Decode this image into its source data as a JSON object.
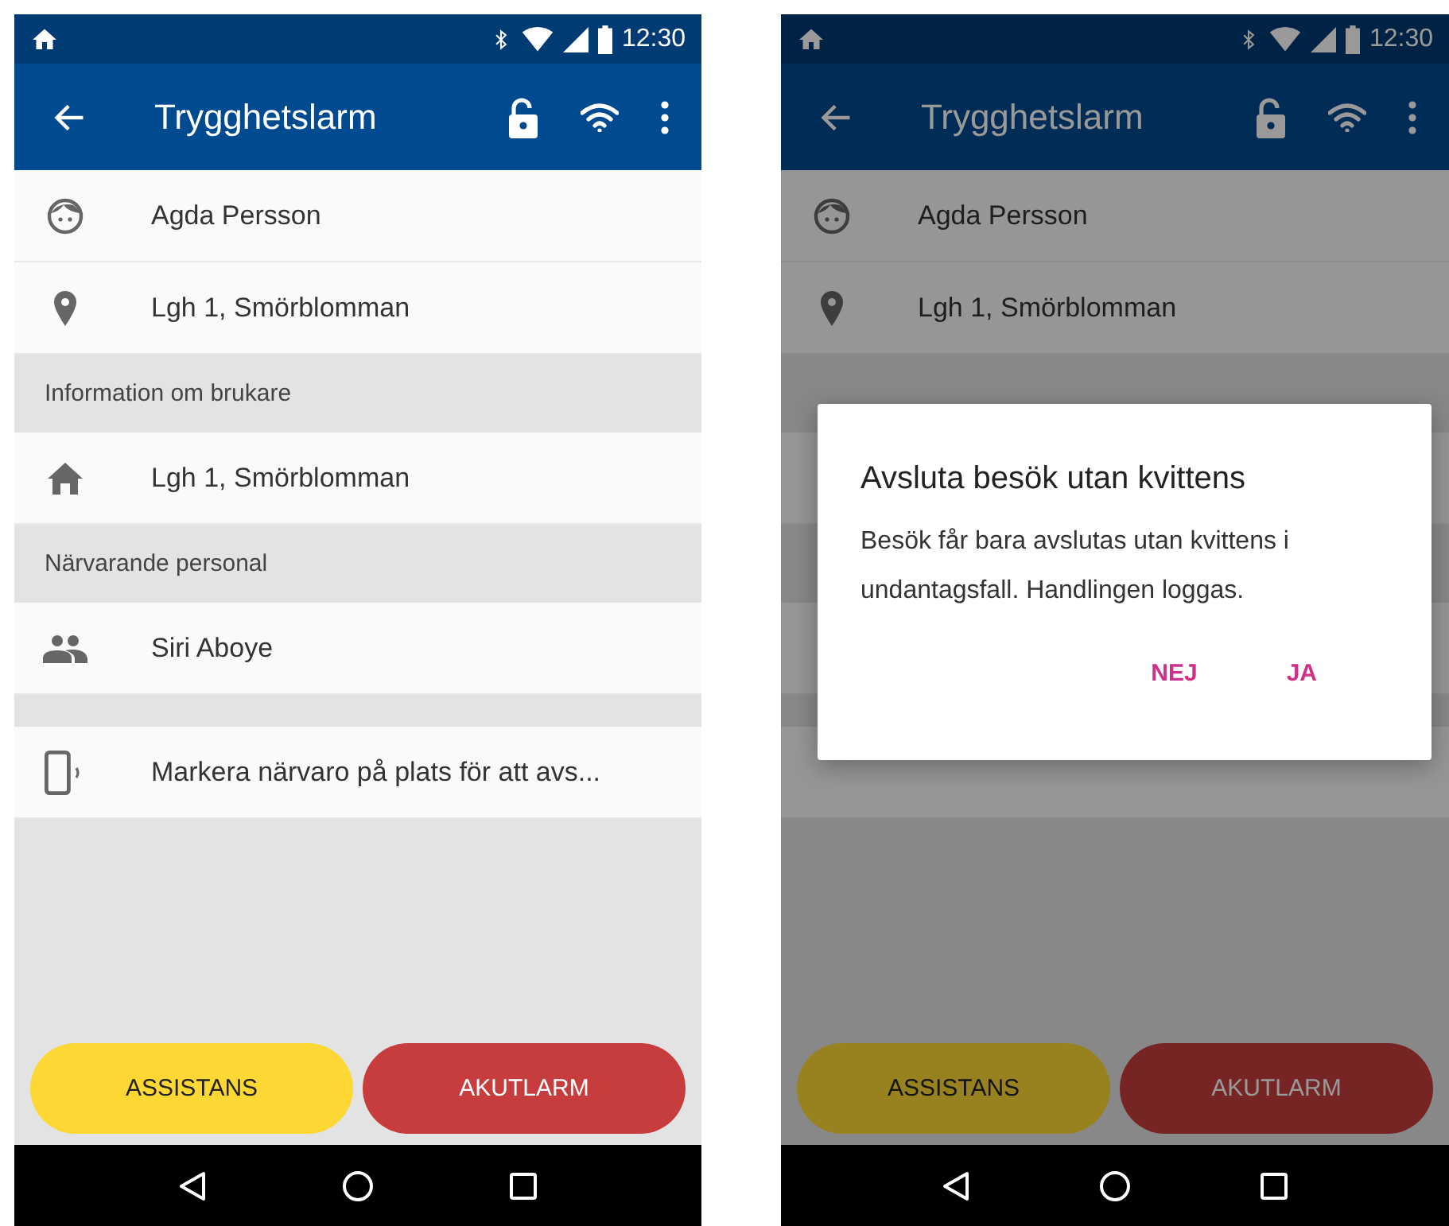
{
  "screens": [
    {
      "status_time": "12:30",
      "title": "Trygghetslarm",
      "dimmed": false,
      "rows": [
        {
          "kind": "user",
          "text": "Agda Persson"
        },
        {
          "kind": "address",
          "text": "Lgh 1, Smörblomman"
        },
        {
          "kind": "header",
          "text": "Information om brukare"
        },
        {
          "kind": "home",
          "text": "Lgh 1, Smörblomman"
        },
        {
          "kind": "header",
          "text": "Närvarande personal"
        },
        {
          "kind": "staff",
          "text": "Siri Aboye"
        },
        {
          "kind": "spacer"
        },
        {
          "kind": "presence",
          "text": "Markera närvaro på plats för att avs..."
        }
      ],
      "buttons": [
        {
          "label": "ASSISTANS",
          "kind": "assist"
        },
        {
          "label": "AKUTLARM",
          "kind": "alarm"
        }
      ]
    },
    {
      "status_time": "12:30",
      "title": "Trygghetslarm",
      "dimmed": true,
      "rows": [
        {
          "kind": "user",
          "text": "Agda Persson"
        },
        {
          "kind": "address",
          "text": "Lgh 1, Smörblomman"
        },
        {
          "kind": "header"
        },
        {
          "kind": "home"
        },
        {
          "kind": "header"
        },
        {
          "kind": "staff"
        },
        {
          "kind": "spacer"
        },
        {
          "kind": "presence"
        }
      ],
      "buttons": [
        {
          "label": "ASSISTANS",
          "kind": "assist"
        },
        {
          "label": "AKUTLARM",
          "kind": "alarm"
        }
      ],
      "dialog": {
        "title": "Avsluta besök utan kvittens",
        "message": "Besök får bara avslutas utan kvittens i undantagsfall. Handlingen loggas.",
        "actions": [
          "NEJ",
          "JA"
        ]
      }
    }
  ]
}
